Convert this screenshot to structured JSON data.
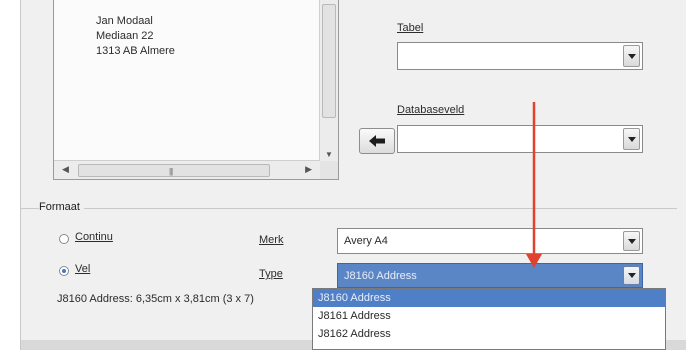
{
  "preview": {
    "lines": [
      "Jan Modaal",
      "Mediaan 22",
      "1313 AB Almere"
    ]
  },
  "fields": {
    "tabel_label": "Tabel",
    "tabel_value": "",
    "databaseveld_label": "Databaseveld",
    "databaseveld_value": ""
  },
  "format": {
    "group_title": "Formaat",
    "continu_label": "Continu",
    "vel_label": "Vel",
    "merk_label": "Merk",
    "merk_value": "Avery A4",
    "type_label": "Type",
    "type_value": "J8160 Address",
    "dimensions": "J8160 Address: 6,35cm x 3,81cm (3 x 7)",
    "selected_option": "vel"
  },
  "type_dropdown": {
    "options": [
      "J8160 Address",
      "J8161 Address",
      "J8162 Address"
    ],
    "highlighted_index": 0
  },
  "colors": {
    "selection": "#5b86c5",
    "guide_arrow": "#e0422f"
  },
  "icons": {
    "arrow_button": "arrow-left-icon",
    "combo": "chevron-down-icon"
  }
}
